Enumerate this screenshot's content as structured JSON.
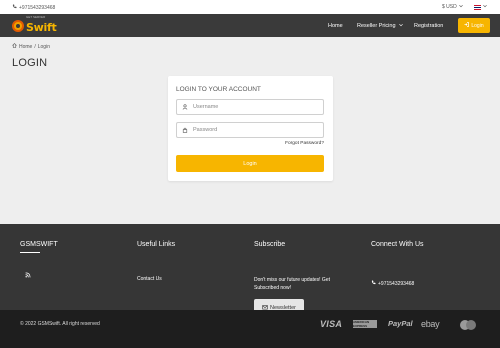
{
  "topbar": {
    "phone": "+971543293468",
    "currency": "$ USD",
    "language_icon": "uk-flag-icon"
  },
  "header": {
    "logo_small": "GET SERVER",
    "logo_word": "Swift",
    "nav": {
      "home": "Home",
      "reseller": "Reseller Pricing",
      "registration": "Registration"
    },
    "login_button": "Login",
    "accent": "#f7b500",
    "background": "#3a3a3a"
  },
  "breadcrumb": {
    "home": "Home",
    "separator": "/",
    "current": "Login"
  },
  "page_title": "LOGIN",
  "login_form": {
    "title": "LOGIN TO YOUR ACCOUNT",
    "username_placeholder": "Username",
    "username_value": "",
    "password_placeholder": "Password",
    "password_value": "",
    "forgot_password": "Forgot Password?",
    "submit_label": "Login"
  },
  "footer": {
    "col1_title": "GSMSWIFT",
    "col2_title": "Useful Links",
    "col2_link": "Contact Us",
    "col3_title": "Subscribe",
    "col3_text": "Don't miss our future updates! Get Subscribed now!",
    "newsletter_button": "Newsletter",
    "col4_title": "Connect With Us",
    "col4_phone": "+971543293468",
    "background": "#363636"
  },
  "bottombar": {
    "copyright": "© 2022 GSMSwift. All right reserved",
    "payments": {
      "visa": "VISA",
      "amex": "AMERICAN EXPRESS",
      "paypal": "PayPal",
      "ebay": "ebay"
    },
    "background": "#1e1e1e"
  }
}
